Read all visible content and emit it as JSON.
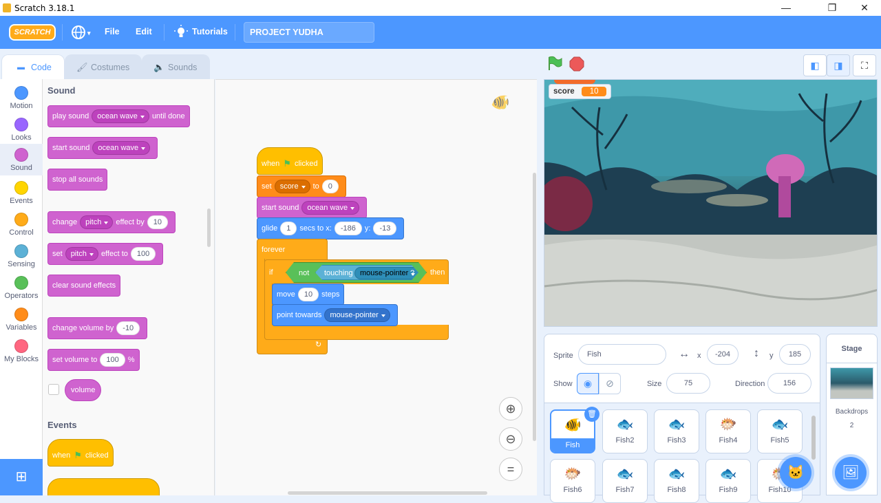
{
  "window": {
    "title": "Scratch 3.18.1",
    "minimize": "—",
    "maximize": "❐",
    "close": "✕"
  },
  "menubar": {
    "logo": "SCRATCH",
    "file": "File",
    "edit": "Edit",
    "tutorials": "Tutorials",
    "project_title": "PROJECT YUDHA"
  },
  "tabs": [
    {
      "label": "Code"
    },
    {
      "label": "Costumes"
    },
    {
      "label": "Sounds"
    }
  ],
  "categories": [
    {
      "label": "Motion",
      "color": "#4c97ff"
    },
    {
      "label": "Looks",
      "color": "#9966ff"
    },
    {
      "label": "Sound",
      "color": "#cf63cf"
    },
    {
      "label": "Events",
      "color": "#ffd500"
    },
    {
      "label": "Control",
      "color": "#ffab19"
    },
    {
      "label": "Sensing",
      "color": "#5cb1d6"
    },
    {
      "label": "Operators",
      "color": "#59c059"
    },
    {
      "label": "Variables",
      "color": "#ff8c1a"
    },
    {
      "label": "My Blocks",
      "color": "#ff6680"
    }
  ],
  "palette": {
    "sound_heading": "Sound",
    "events_heading": "Events",
    "play_sound": "play sound",
    "ocean_wave": "ocean wave",
    "until_done": "until done",
    "start_sound": "start sound",
    "stop_all_sounds": "stop all sounds",
    "change": "change",
    "pitch": "pitch",
    "effect_by": "effect by",
    "ten": "10",
    "set": "set",
    "effect_to": "effect to",
    "hundred": "100",
    "clear_sound_effects": "clear sound effects",
    "change_volume_by": "change volume by",
    "minus_ten": "-10",
    "set_volume_to": "set volume to",
    "percent": "%",
    "volume": "volume",
    "when": "when",
    "clicked": "clicked"
  },
  "script": {
    "when": "when",
    "clicked": "clicked",
    "set": "set",
    "var_score": "score",
    "to": "to",
    "zero": "0",
    "start_sound": "start sound",
    "ocean_wave": "ocean wave",
    "glide": "glide",
    "one": "1",
    "secs_to_x": "secs to x:",
    "x_val": "-186",
    "y_label": "y:",
    "y_val": "-13",
    "forever": "forever",
    "if": "if",
    "not": "not",
    "touching": "touching",
    "mouse_pointer": "mouse-pointer",
    "question": "?",
    "then": "then",
    "move": "move",
    "ten": "10",
    "steps": "steps",
    "point_towards": "point towards"
  },
  "stage": {
    "monitor_label": "score",
    "monitor_value": "10"
  },
  "sprite_info": {
    "sprite_label": "Sprite",
    "sprite_name": "Fish",
    "x_label": "x",
    "x_value": "-204",
    "y_label": "y",
    "y_value": "185",
    "show_label": "Show",
    "size_label": "Size",
    "size_value": "75",
    "direction_label": "Direction",
    "direction_value": "156"
  },
  "sprites": [
    {
      "name": "Fish"
    },
    {
      "name": "Fish2"
    },
    {
      "name": "Fish3"
    },
    {
      "name": "Fish4"
    },
    {
      "name": "Fish5"
    },
    {
      "name": "Fish6"
    },
    {
      "name": "Fish7"
    },
    {
      "name": "Fish8"
    },
    {
      "name": "Fish9"
    },
    {
      "name": "Fish10"
    }
  ],
  "stage_pane": {
    "title": "Stage",
    "backdrops_label": "Backdrops",
    "backdrops_count": "2"
  }
}
